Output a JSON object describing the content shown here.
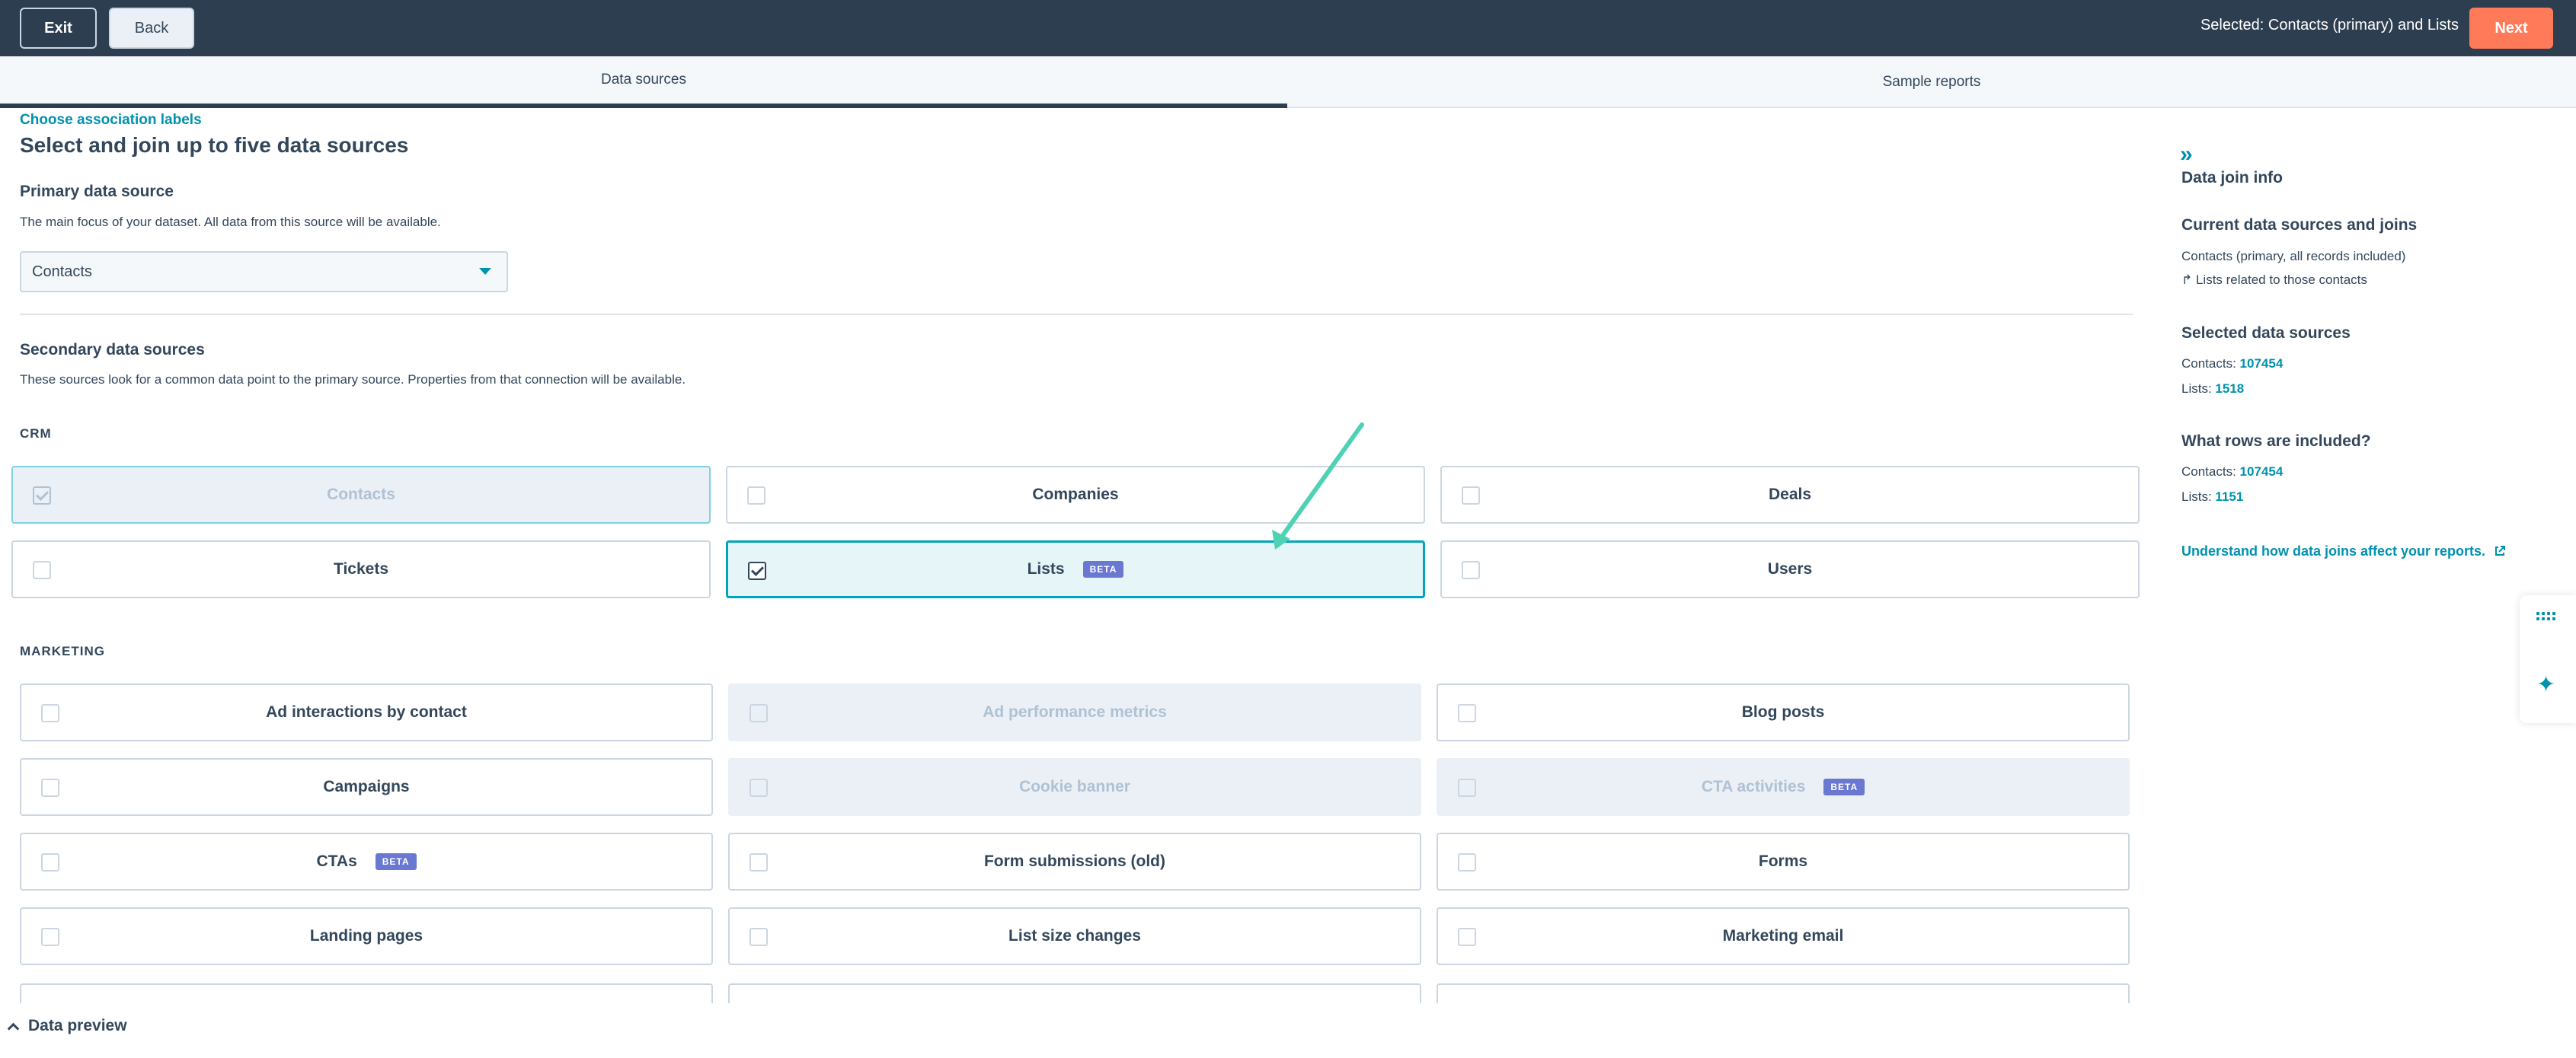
{
  "topbar": {
    "exit_label": "Exit",
    "back_label": "Back",
    "selected_text": "Selected: Contacts (primary) and Lists",
    "next_label": "Next"
  },
  "tabs": [
    {
      "label": "Data sources",
      "active": true
    },
    {
      "label": "Sample reports",
      "active": false
    }
  ],
  "main": {
    "assoc_link": "Choose association labels",
    "title": "Select and join up to five data sources",
    "primary": {
      "heading": "Primary data source",
      "description": "The main focus of your dataset. All data from this source will be available.",
      "selected": "Contacts"
    },
    "secondary": {
      "heading": "Secondary data sources",
      "description": "These sources look for a common data point to the primary source. Properties from that connection will be available."
    },
    "groups": [
      {
        "label": "CRM",
        "items": [
          {
            "label": "Contacts",
            "state": "checked-disabled"
          },
          {
            "label": "Companies",
            "state": "unchecked"
          },
          {
            "label": "Deals",
            "state": "unchecked"
          },
          {
            "label": "Tickets",
            "state": "unchecked"
          },
          {
            "label": "Lists",
            "state": "checked",
            "badge": "BETA"
          },
          {
            "label": "Users",
            "state": "unchecked"
          }
        ]
      },
      {
        "label": "MARKETING",
        "items": [
          {
            "label": "Ad interactions by contact",
            "state": "unchecked"
          },
          {
            "label": "Ad performance metrics",
            "state": "disabled"
          },
          {
            "label": "Blog posts",
            "state": "unchecked"
          },
          {
            "label": "Campaigns",
            "state": "unchecked"
          },
          {
            "label": "Cookie banner",
            "state": "disabled"
          },
          {
            "label": "CTA activities",
            "state": "disabled",
            "badge": "BETA"
          },
          {
            "label": "CTAs",
            "state": "unchecked",
            "badge": "BETA"
          },
          {
            "label": "Form submissions (old)",
            "state": "unchecked"
          },
          {
            "label": "Forms",
            "state": "unchecked"
          },
          {
            "label": "Landing pages",
            "state": "unchecked"
          },
          {
            "label": "List size changes",
            "state": "unchecked"
          },
          {
            "label": "Marketing email",
            "state": "unchecked"
          }
        ]
      }
    ]
  },
  "panel": {
    "title": "Data join info",
    "current_heading": "Current data sources and joins",
    "current_primary": "Contacts (primary, all records included)",
    "current_join": "↱ Lists related to those contacts",
    "selected_heading": "Selected data sources",
    "selected_contacts_label": "Contacts:",
    "selected_contacts_value": "107454",
    "selected_lists_label": "Lists:",
    "selected_lists_value": "1518",
    "rows_heading": "What rows are included?",
    "rows_contacts_label": "Contacts:",
    "rows_contacts_value": "107454",
    "rows_lists_label": "Lists:",
    "rows_lists_value": "1151",
    "link": "Understand how data joins affect your reports.",
    "link_icon": "external-link-icon"
  },
  "footer": {
    "preview_label": "Data preview"
  },
  "colors": {
    "topbar": "#2d3e50",
    "accent": "#0091ae",
    "next_button": "#ff7a59",
    "selected_card_border": "#00a4bd",
    "badge": "#6a78d1",
    "annotation_arrow": "#4fd1b5"
  }
}
